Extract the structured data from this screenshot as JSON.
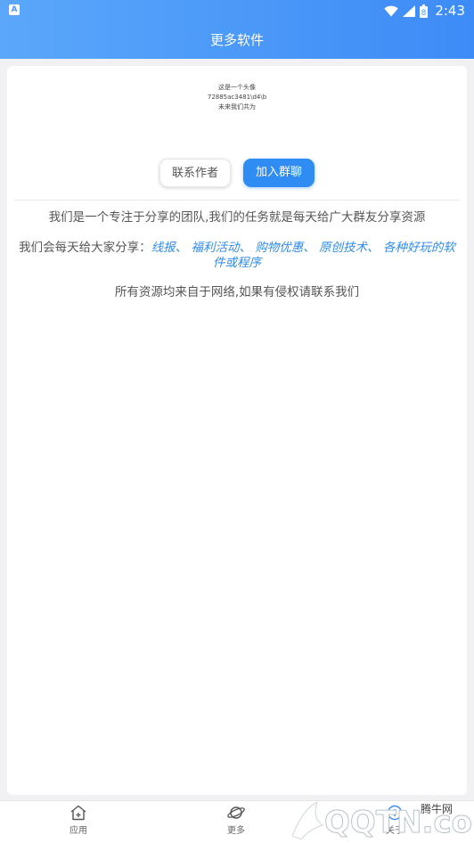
{
  "status_bar": {
    "app_icon_letter": "A",
    "time": "2:43",
    "battery_glyph": "8"
  },
  "header": {
    "title": "更多软件"
  },
  "info": {
    "lines": [
      "这是一个头像",
      "72885ac3481\\d4\\b",
      "未来我们共为"
    ]
  },
  "buttons": {
    "contact": "联系作者",
    "join": "加入群聊"
  },
  "content": {
    "line1": "我们是一个专注于分享的团队,我们的任务就是每天给广大群友分享资源",
    "line2_prefix": "我们会每天给大家分享：",
    "line2_highlight": "线报、 福利活动、 购物优惠、 原创技术、 各种好玩的软件或程序",
    "line3": "所有资源均来自于网络,如果有侵权请联系我们"
  },
  "tabs": [
    {
      "label": "应用",
      "icon": "home-icon"
    },
    {
      "label": "更多",
      "icon": "planet-icon"
    },
    {
      "label": "关于",
      "icon": "info-icon"
    }
  ],
  "watermark": {
    "brand": "腾牛网",
    "domain": "QQTN.com"
  },
  "colors": {
    "header_start": "#5aa7fb",
    "header_end": "#3d8bf6",
    "accent": "#2f8cf2"
  }
}
